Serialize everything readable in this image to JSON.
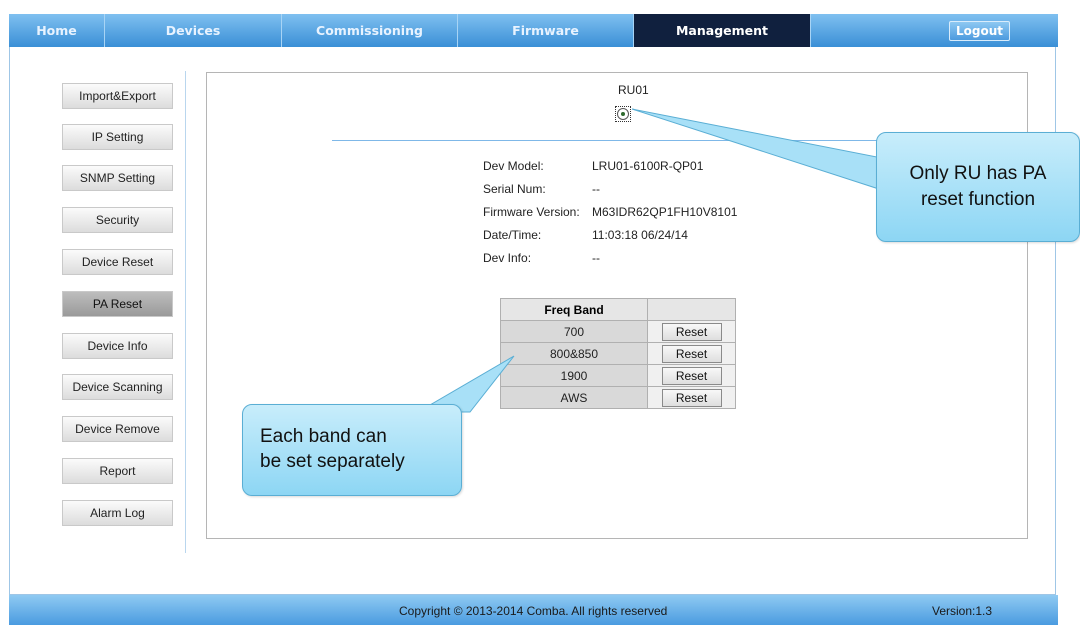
{
  "nav": {
    "tabs": [
      {
        "label": "Home"
      },
      {
        "label": "Devices"
      },
      {
        "label": "Commissioning"
      },
      {
        "label": "Firmware"
      },
      {
        "label": "Management"
      }
    ],
    "active_tab": "Management",
    "logout_label": "Logout"
  },
  "sidebar": {
    "items": [
      {
        "label": "Import&Export"
      },
      {
        "label": "IP Setting"
      },
      {
        "label": "SNMP Setting"
      },
      {
        "label": "Security"
      },
      {
        "label": "Device Reset"
      },
      {
        "label": "PA Reset"
      },
      {
        "label": "Device Info"
      },
      {
        "label": "Device Scanning"
      },
      {
        "label": "Device Remove"
      },
      {
        "label": "Report"
      },
      {
        "label": "Alarm Log"
      }
    ],
    "active_item": "PA Reset"
  },
  "device": {
    "name": "RU01",
    "fields": [
      {
        "label": "Dev Model:",
        "value": "LRU01-6100R-QP01"
      },
      {
        "label": "Serial Num:",
        "value": "--"
      },
      {
        "label": "Firmware Version:",
        "value": "M63IDR62QP1FH10V8101"
      },
      {
        "label": "Date/Time:",
        "value": "11:03:18 06/24/14"
      },
      {
        "label": "Dev Info:",
        "value": "--"
      }
    ]
  },
  "freq_table": {
    "header": "Freq Band",
    "rows": [
      {
        "band": "700",
        "action": "Reset"
      },
      {
        "band": "800&850",
        "action": "Reset"
      },
      {
        "band": "1900",
        "action": "Reset"
      },
      {
        "band": "AWS",
        "action": "Reset"
      }
    ]
  },
  "callouts": {
    "ru_note": [
      "Only RU has PA",
      "reset function"
    ],
    "band_note": [
      "Each band can",
      "be set separately"
    ]
  },
  "footer": {
    "copyright": "Copyright © 2013-2014 Comba. All rights reserved",
    "version": "Version:1.3"
  },
  "colors": {
    "nav_active": "#10203e",
    "nav_gradient_top": "#7fc0f0",
    "callout_fill": "#8dd6f4"
  }
}
